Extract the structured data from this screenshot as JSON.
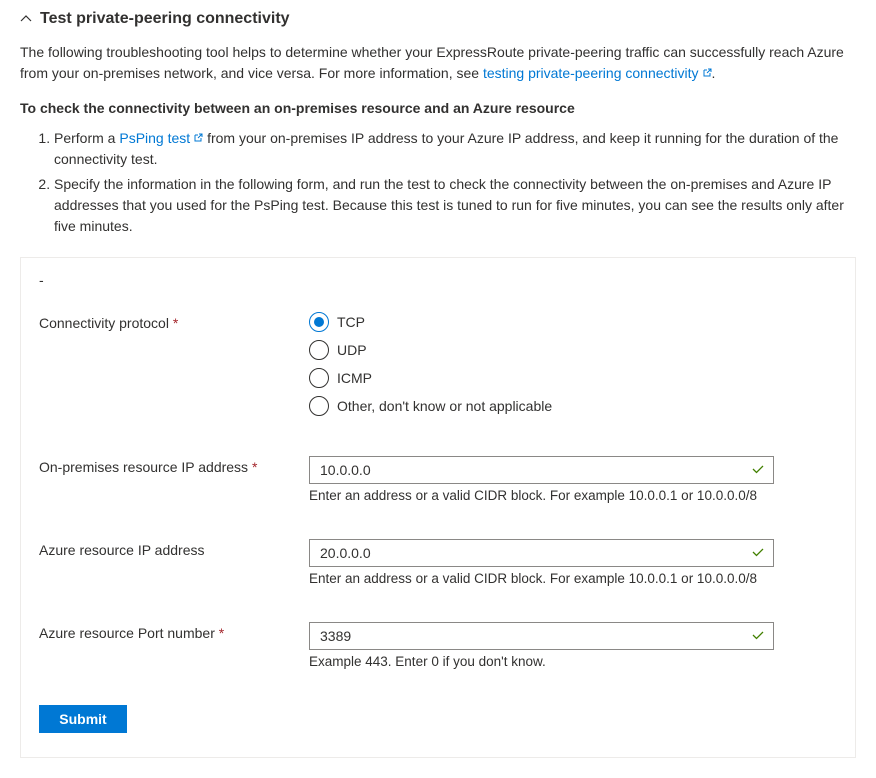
{
  "header": {
    "title": "Test private-peering connectivity"
  },
  "description": {
    "text1": "The following troubleshooting tool helps to determine whether your ExpressRoute private-peering traffic can successfully reach Azure from your on-premises network, and vice versa. For more information, see ",
    "link1": "testing private-peering connectivity",
    "text2": "."
  },
  "subheading": "To check the connectivity between an on-premises resource and an Azure resource",
  "steps": {
    "item1a": "Perform a ",
    "item1link": "PsPing test",
    "item1b": " from your on-premises IP address to your Azure IP address, and keep it running for the duration of the connectivity test.",
    "item2": "Specify the information in the following form, and run the test to check the connectivity between the on-premises and Azure IP addresses that you used for the PsPing test. Because this test is tuned to run for five minutes, you can see the results only after five minutes."
  },
  "form": {
    "minus": "-",
    "protocol": {
      "label": "Connectivity protocol",
      "options": {
        "tcp": "TCP",
        "udp": "UDP",
        "icmp": "ICMP",
        "other": "Other, don't know or not applicable"
      },
      "selected": "tcp"
    },
    "onprem_ip": {
      "label": "On-premises resource IP address",
      "value": "10.0.0.0",
      "helper": "Enter an address or a valid CIDR block. For example 10.0.0.1 or 10.0.0.0/8"
    },
    "azure_ip": {
      "label": "Azure resource IP address",
      "value": "20.0.0.0",
      "helper": "Enter an address or a valid CIDR block. For example 10.0.0.1 or 10.0.0.0/8"
    },
    "azure_port": {
      "label": "Azure resource Port number",
      "value": "3389",
      "helper": "Example 443. Enter 0 if you don't know."
    },
    "submit_label": "Submit"
  }
}
